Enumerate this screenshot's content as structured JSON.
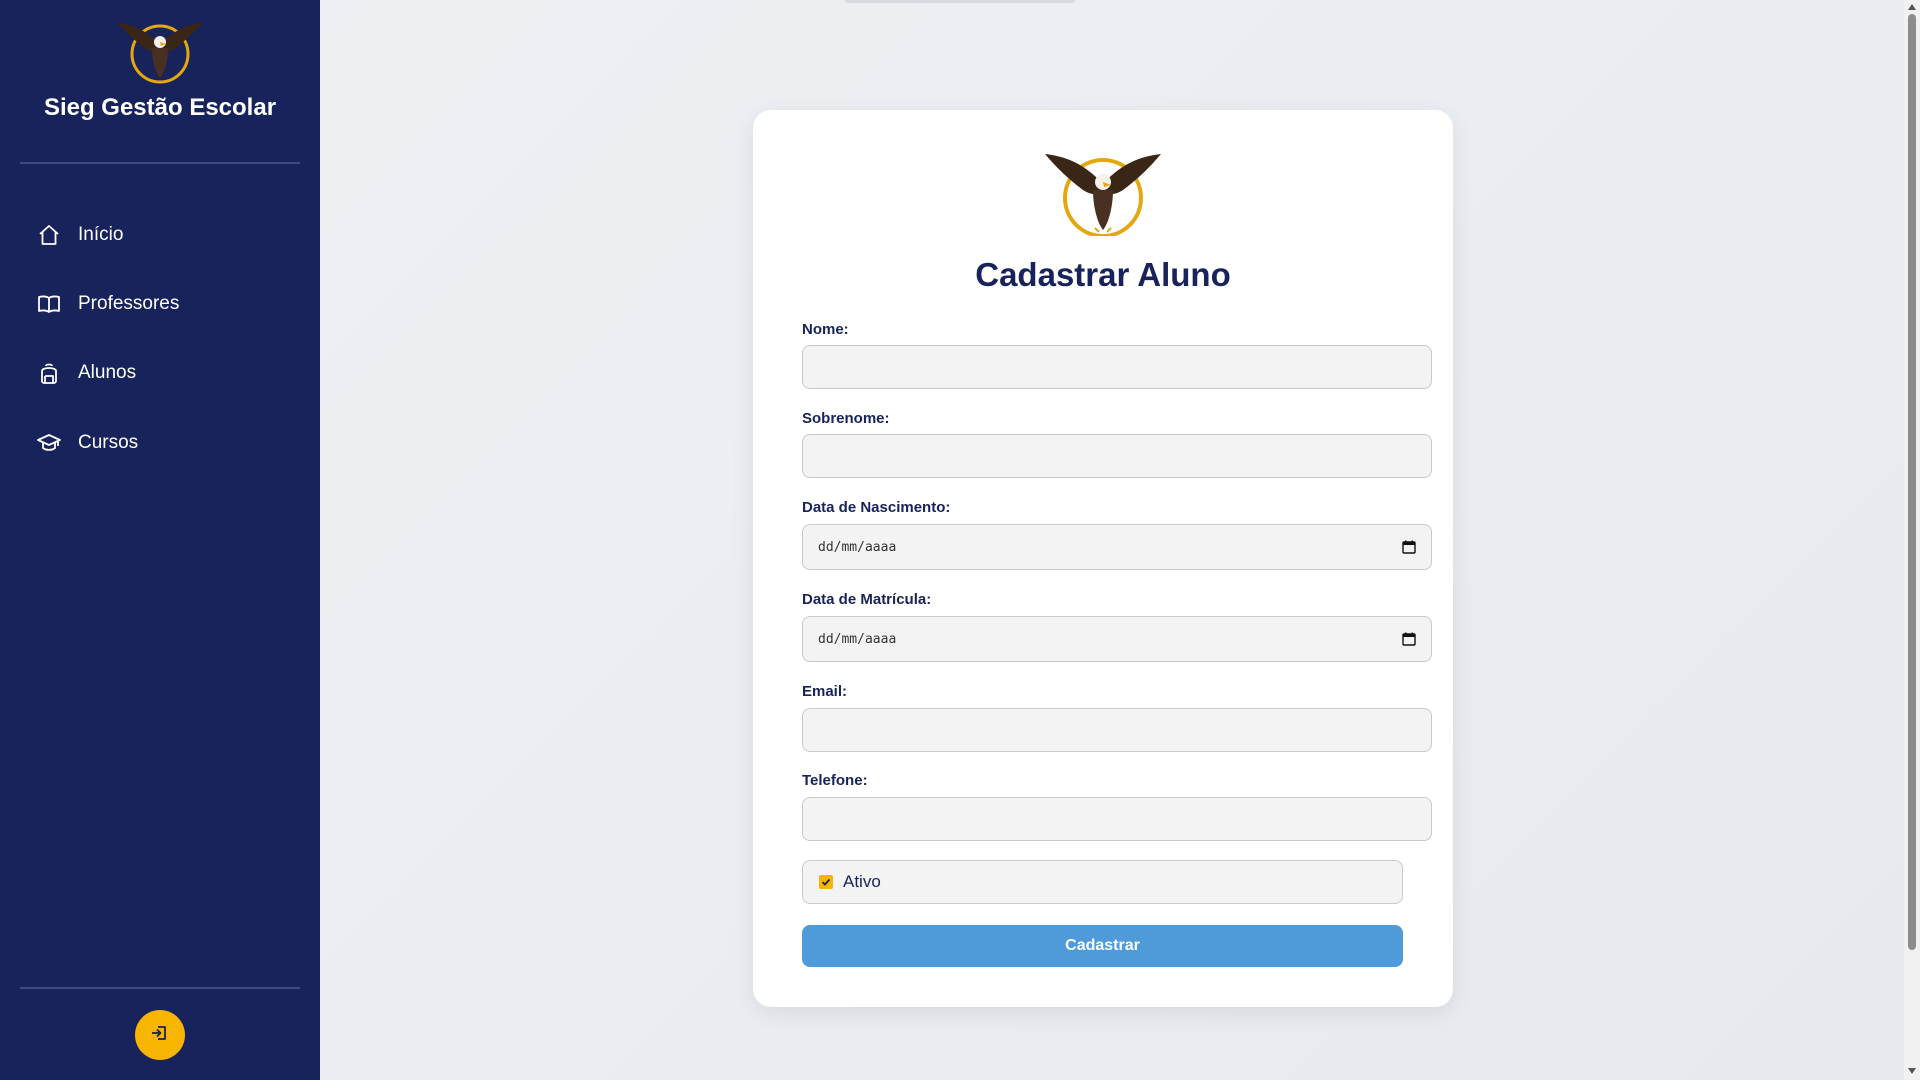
{
  "app": {
    "title": "Sieg Gestão Escolar"
  },
  "sidebar": {
    "items": [
      {
        "label": "Início",
        "icon": "home-icon"
      },
      {
        "label": "Professores",
        "icon": "book-icon"
      },
      {
        "label": "Alunos",
        "icon": "backpack-icon"
      },
      {
        "label": "Cursos",
        "icon": "graduation-cap-icon"
      }
    ],
    "logout_icon": "logout-icon"
  },
  "form": {
    "title": "Cadastrar Aluno",
    "fields": {
      "nome": {
        "label": "Nome:",
        "value": ""
      },
      "sobrenome": {
        "label": "Sobrenome:",
        "value": ""
      },
      "nascimento": {
        "label": "Data de Nascimento:",
        "placeholder": "dd/mm/aaaa"
      },
      "matricula": {
        "label": "Data de Matrícula:",
        "placeholder": "dd/mm/aaaa"
      },
      "email": {
        "label": "Email:",
        "value": ""
      },
      "telefone": {
        "label": "Telefone:",
        "value": ""
      }
    },
    "ativo": {
      "label": "Ativo",
      "checked": true
    },
    "submit_label": "Cadastrar"
  },
  "colors": {
    "sidebar_bg": "#17235a",
    "accent_yellow": "#f7b500",
    "button_blue": "#4f9bd9",
    "title_navy": "#17235a"
  }
}
